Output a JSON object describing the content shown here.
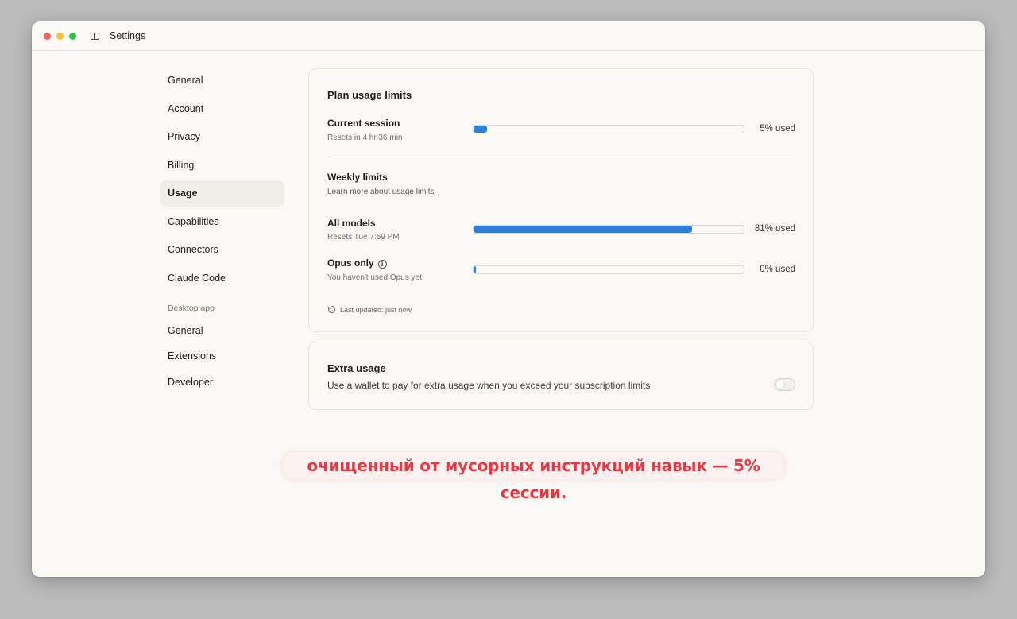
{
  "window": {
    "title": "Settings"
  },
  "nav": {
    "items": [
      "General",
      "Account",
      "Privacy",
      "Billing",
      "Usage",
      "Capabilities",
      "Connectors",
      "Claude Code"
    ],
    "section_label": "Desktop app",
    "desktop_items": [
      "General",
      "Extensions",
      "Developer"
    ],
    "active": "Usage"
  },
  "plan": {
    "title": "Plan usage limits",
    "session": {
      "label": "Current session",
      "sub": "Resets in 4 hr 36 min",
      "percent": 5,
      "used": "5% used"
    },
    "weekly": {
      "title": "Weekly limits",
      "link": "Learn more about usage limits"
    },
    "all_models": {
      "label": "All models",
      "sub": "Resets Tue 7:59 PM",
      "percent": 81,
      "used": "81% used"
    },
    "opus": {
      "label": "Opus only",
      "sub": "You haven't used Opus yet",
      "percent": 0,
      "used": "0% used"
    },
    "updated": "Last updated: just now"
  },
  "extra": {
    "title": "Extra usage",
    "description": "Use a wallet to pay for extra usage when you exceed your subscription limits",
    "enabled": false
  },
  "caption": "очищенный от мусорных инструкций навык — 5% сессии.",
  "colors": {
    "accent": "#2f7fd6",
    "caption_text": "#e43a44",
    "background": "#faf9f5"
  }
}
